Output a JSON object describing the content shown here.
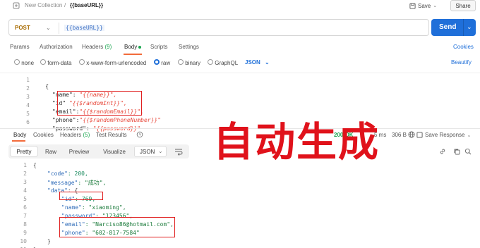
{
  "breadcrumb": {
    "collection": "New Collection",
    "separator": "/",
    "request": "{{baseURL}}"
  },
  "header": {
    "save_label": "Save",
    "share_label": "Share"
  },
  "request": {
    "method": "POST",
    "url": "{{baseURL}}",
    "send_label": "Send",
    "tabs": [
      "Params",
      "Authorization",
      "Headers",
      "(9)",
      "Body",
      "Scripts",
      "Settings"
    ],
    "cookies_label": "Cookies"
  },
  "body_types": [
    "none",
    "form-data",
    "x-www-form-urlencoded",
    "raw",
    "binary",
    "GraphQL"
  ],
  "body_format": "JSON",
  "beautify_label": "Beautify",
  "request_body": {
    "line_numbers": [
      "1",
      "2",
      "3",
      "4",
      "5",
      "6"
    ],
    "lines": [
      {
        "k": "{",
        "v": ""
      },
      {
        "k": "  \"name\": ",
        "v": "\"{{name}}\","
      },
      {
        "k": "  \"id\" ",
        "v": "\"{{$randomInt}}\","
      },
      {
        "k": "  \"email\":",
        "v": "\"{{$randomEmail}}\","
      },
      {
        "k": "  \"phone\":",
        "v": "\"{{$randomPhoneNumber}}\""
      },
      {
        "k": "  \"password\": ",
        "v": "\"{{password}}\""
      }
    ]
  },
  "response": {
    "tabs": [
      "Body",
      "Cookies",
      "Headers",
      "(5)",
      "Test Results"
    ],
    "status": "200 OK",
    "time": "5 ms",
    "size": "306 B",
    "save_response": "Save Response",
    "views": [
      "Pretty",
      "Raw",
      "Preview",
      "Visualize"
    ],
    "format": "JSON",
    "line_numbers": [
      "1",
      "2",
      "3",
      "4",
      "5",
      "6",
      "7",
      "8",
      "9",
      "10",
      "11"
    ],
    "lines": [
      {
        "indent": 0,
        "key": "",
        "value": "{"
      },
      {
        "indent": 1,
        "key": "\"code\"",
        "value": ": 200,"
      },
      {
        "indent": 1,
        "key": "\"message\"",
        "value": ": \"成功\","
      },
      {
        "indent": 1,
        "key": "\"data\"",
        "value": ": {"
      },
      {
        "indent": 2,
        "key": "\"id\"",
        "value": ": 769,"
      },
      {
        "indent": 2,
        "key": "\"name\"",
        "value": ": \"xiaoming\","
      },
      {
        "indent": 2,
        "key": "\"password\"",
        "value": ": \"123456\","
      },
      {
        "indent": 2,
        "key": "\"email\"",
        "value": ": \"Narciso86@hotmail.com\","
      },
      {
        "indent": 2,
        "key": "\"phone\"",
        "value": ": \"602-817-7584\""
      },
      {
        "indent": 1,
        "key": "",
        "value": "}"
      },
      {
        "indent": 0,
        "key": "",
        "value": "}"
      }
    ]
  },
  "overlay_caption": "自动生成",
  "colors": {
    "accent": "#1f6fd9",
    "annotation": "#e02020",
    "tab_active": "#f26b3a",
    "status_ok": "#1aa64f"
  }
}
